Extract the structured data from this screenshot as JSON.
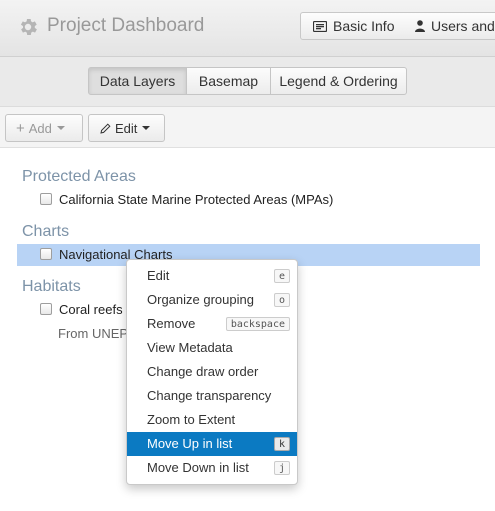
{
  "header": {
    "title": "Project Dashboard",
    "gear_icon": "gear-icon",
    "buttons": [
      {
        "label": "Basic Info",
        "icon": "info-card-icon"
      },
      {
        "label": "Users and G",
        "icon": "user-icon"
      }
    ]
  },
  "tabs": [
    {
      "label": "Data Layers",
      "active": true
    },
    {
      "label": "Basemap",
      "active": false
    },
    {
      "label": "Legend & Ordering",
      "active": false
    }
  ],
  "toolbar": {
    "add_label": "Add",
    "edit_label": "Edit"
  },
  "groups": [
    {
      "title": "Protected Areas",
      "layers": [
        {
          "label": "California State Marine Protected Areas (MPAs)",
          "checked": false
        }
      ]
    },
    {
      "title": "Charts",
      "layers": [
        {
          "label": "Navigational Charts",
          "checked": false,
          "selected": true
        }
      ]
    },
    {
      "title": "Habitats",
      "layers": [
        {
          "label": "Coral reefs",
          "checked": false,
          "description": "From UNEP"
        }
      ]
    }
  ],
  "context_menu": {
    "items": [
      {
        "label": "Edit",
        "shortcut": "e"
      },
      {
        "label": "Organize grouping",
        "shortcut": "o"
      },
      {
        "label": "Remove",
        "shortcut": "backspace"
      },
      {
        "label": "View Metadata",
        "shortcut": ""
      },
      {
        "label": "Change draw order",
        "shortcut": ""
      },
      {
        "label": "Change transparency",
        "shortcut": ""
      },
      {
        "label": "Zoom to Extent",
        "shortcut": ""
      },
      {
        "label": "Move Up in list",
        "shortcut": "k",
        "highlighted": true
      },
      {
        "label": "Move Down in list",
        "shortcut": "j"
      }
    ]
  },
  "colors": {
    "accent": "#0b7ac2",
    "selected_row": "#b8d3f5",
    "group_title": "#7d93a8"
  }
}
